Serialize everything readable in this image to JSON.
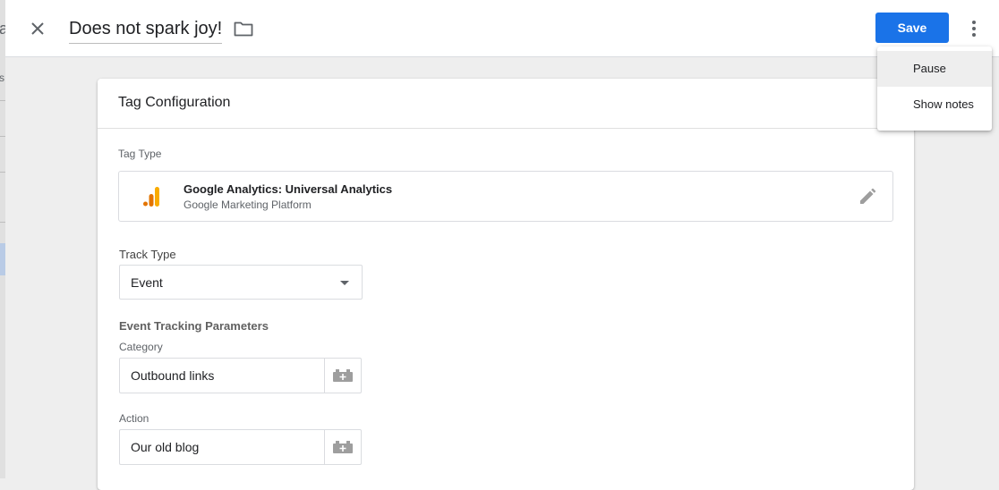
{
  "underlay": {
    "frag_a": "a",
    "frag_s": "s"
  },
  "header": {
    "title": "Does not spark joy!",
    "save_label": "Save",
    "accent": "#1a73e8"
  },
  "menu": {
    "items": [
      {
        "label": "Pause"
      },
      {
        "label": "Show notes"
      }
    ]
  },
  "card": {
    "title": "Tag Configuration",
    "tag_type_label": "Tag Type",
    "tag_type": {
      "name": "Google Analytics: Universal Analytics",
      "provider": "Google Marketing Platform",
      "icon": "google-analytics-icon"
    },
    "track_type_label": "Track Type",
    "track_type_value": "Event",
    "params_label": "Event Tracking Parameters",
    "category_label": "Category",
    "category_value": "Outbound links",
    "action_label": "Action",
    "action_value": "Our old blog"
  }
}
